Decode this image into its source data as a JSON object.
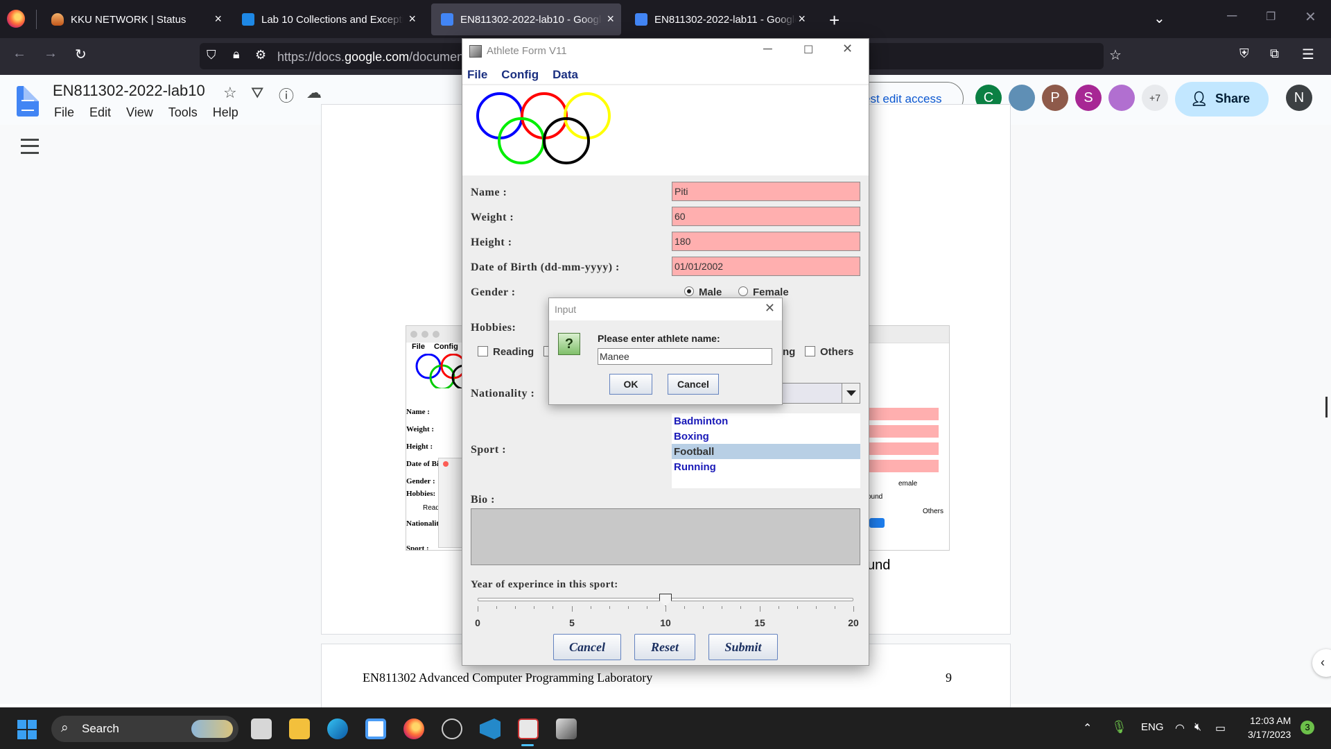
{
  "browser": {
    "tabs": [
      {
        "title": "KKU NETWORK | Status",
        "icon": "fire-warning-icon"
      },
      {
        "title": "Lab 10 Collections and Exceptio",
        "icon": "google-classroom-icon"
      },
      {
        "title": "EN811302-2022-lab10 - Google",
        "icon": "google-docs-icon",
        "active": true
      },
      {
        "title": "EN811302-2022-lab11 - Google",
        "icon": "google-docs-icon"
      }
    ],
    "url_prefix": "https://docs.",
    "url_domain": "google.com",
    "url_rest": "/documen"
  },
  "docs": {
    "title": "EN811302-2022-lab10",
    "menu": [
      "File",
      "Edit",
      "View",
      "Tools",
      "Help"
    ],
    "access_button": "est edit access",
    "collaborators": [
      {
        "letter": "C",
        "color": "#0b8043"
      },
      {
        "letter": "",
        "color": "#5f8fb5"
      },
      {
        "letter": "P",
        "color": "#8e5a4a"
      },
      {
        "letter": "S",
        "color": "#a72794"
      },
      {
        "letter": "",
        "color": "#b16fd0"
      }
    ],
    "more_count": "+7",
    "share_label": "Share",
    "user_initial": "N",
    "body_fragment": "und",
    "footer_text": "EN811302 Advanced Computer Programming Laboratory",
    "footer_page": "9",
    "embed": {
      "menu": [
        "File",
        "Config"
      ],
      "labels": [
        "Name :",
        "Weight :",
        "Height :",
        "Date of Bi",
        "Gender :",
        "Hobbies:",
        "Nationalit",
        "Sport :"
      ],
      "hobby_fragment": "Read",
      "right_fragments": [
        "emale",
        "ound",
        "Others"
      ]
    }
  },
  "athlete_form": {
    "title": "Athlete Form V11",
    "menu": [
      "File",
      "Config",
      "Data"
    ],
    "labels": {
      "name": "Name :",
      "weight": "Weight :",
      "height": "Height :",
      "dob": "Date of Birth (dd-mm-yyyy) :",
      "gender": "Gender :",
      "hobbies": "Hobbies:",
      "nationality": "Nationality :",
      "sport": "Sport :",
      "bio": "Bio :",
      "experience": "Year of experince in this sport:"
    },
    "values": {
      "name": "Piti",
      "weight": "60",
      "height": "180",
      "dob": "01/01/2002"
    },
    "gender_options": {
      "male": "Male",
      "female": "Female",
      "selected": "Male"
    },
    "hobbies": {
      "first": "Reading",
      "partial": "ng",
      "last": "Others"
    },
    "sports": [
      "Badminton",
      "Boxing",
      "Football",
      "Running"
    ],
    "selected_sport": "Football",
    "experience": {
      "min": 0,
      "max": 20,
      "value": 10,
      "tick_labels": [
        "0",
        "5",
        "10",
        "15",
        "20"
      ]
    },
    "buttons": {
      "cancel": "Cancel",
      "reset": "Reset",
      "submit": "Submit"
    }
  },
  "input_dialog": {
    "title": "Input",
    "message": "Please enter athlete name:",
    "value": "Manee",
    "ok": "OK",
    "cancel": "Cancel",
    "icon": "question-icon"
  },
  "taskbar": {
    "search_label": "Search",
    "language": "ENG",
    "time": "12:03 AM",
    "date": "3/17/2023",
    "notifications": "3"
  }
}
